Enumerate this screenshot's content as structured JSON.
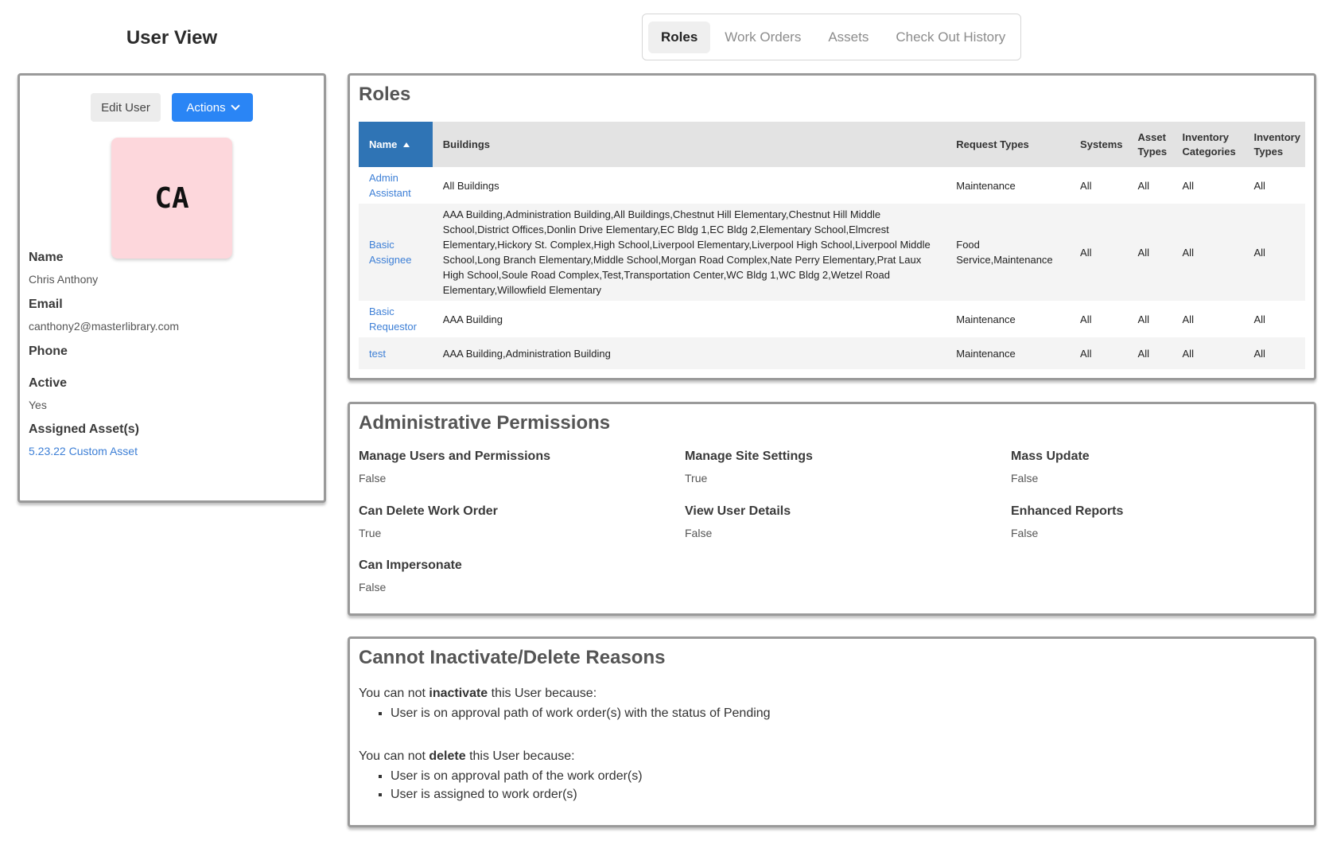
{
  "page_title": "User View",
  "tabs": [
    {
      "label": "Roles"
    },
    {
      "label": "Work Orders"
    },
    {
      "label": "Assets"
    },
    {
      "label": "Check Out History"
    }
  ],
  "user": {
    "edit_label": "Edit User",
    "actions_label": "Actions",
    "initials": "CA",
    "avatar_color": "#fdd7dc",
    "fields": {
      "name_label": "Name",
      "name_value": "Chris Anthony",
      "email_label": "Email",
      "email_value": "canthony2@masterlibrary.com",
      "phone_label": "Phone",
      "active_label": "Active",
      "active_value": "Yes",
      "assets_label": "Assigned Asset(s)",
      "assets_value": "5.23.22 Custom Asset"
    }
  },
  "roles": {
    "title": "Roles",
    "headers": [
      "Name",
      "Buildings",
      "Request Types",
      "Systems",
      "Asset Types",
      "Inventory Categories",
      "Inventory Types"
    ],
    "rows": [
      {
        "name": "Admin Assistant",
        "buildings": "All Buildings",
        "request_types": "Maintenance",
        "systems": "All",
        "asset_types": "All",
        "inventory_categories": "All",
        "inventory_types": "All"
      },
      {
        "name": "Basic Assignee",
        "buildings": "AAA Building,Administration Building,All Buildings,Chestnut Hill Elementary,Chestnut Hill Middle School,District Offices,Donlin Drive Elementary,EC Bldg 1,EC Bldg 2,Elementary School,Elmcrest Elementary,Hickory St. Complex,High School,Liverpool Elementary,Liverpool High School,Liverpool Middle School,Long Branch Elementary,Middle School,Morgan Road Complex,Nate Perry Elementary,Prat Laux High School,Soule Road Complex,Test,Transportation Center,WC Bldg 1,WC Bldg 2,Wetzel Road Elementary,Willowfield Elementary",
        "request_types": "Food Service,Maintenance",
        "systems": "All",
        "asset_types": "All",
        "inventory_categories": "All",
        "inventory_types": "All"
      },
      {
        "name": "Basic Requestor",
        "buildings": "AAA Building",
        "request_types": "Maintenance",
        "systems": "All",
        "asset_types": "All",
        "inventory_categories": "All",
        "inventory_types": "All"
      },
      {
        "name": "test",
        "buildings": "AAA Building,Administration Building",
        "request_types": "Maintenance",
        "systems": "All",
        "asset_types": "All",
        "inventory_categories": "All",
        "inventory_types": "All"
      }
    ]
  },
  "permissions": {
    "title": "Administrative Permissions",
    "items": [
      {
        "label": "Manage Users and Permissions",
        "value": "False"
      },
      {
        "label": "Manage Site Settings",
        "value": "True"
      },
      {
        "label": "Mass Update",
        "value": "False"
      },
      {
        "label": "Can Delete Work Order",
        "value": "True"
      },
      {
        "label": "View User Details",
        "value": "False"
      },
      {
        "label": "Enhanced Reports",
        "value": "False"
      },
      {
        "label": "Can Impersonate",
        "value": "False"
      }
    ]
  },
  "reasons": {
    "title": "Cannot Inactivate/Delete Reasons",
    "inactivate_prefix": "You can not ",
    "inactivate_word": "inactivate",
    "inactivate_suffix": " this User because:",
    "inactivate_items": [
      "User is on approval path of work order(s) with the status of Pending"
    ],
    "delete_prefix": "You can not ",
    "delete_word": "delete",
    "delete_suffix": " this User because:",
    "delete_items": [
      "User is on approval path of the work order(s)",
      "User is assigned to work order(s)"
    ]
  },
  "colors": {
    "accent": "#2a85f5",
    "header_sorted": "#2f74b5",
    "link": "#3d7fd6"
  }
}
